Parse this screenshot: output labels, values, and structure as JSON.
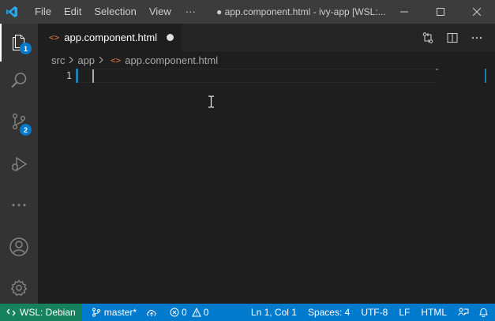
{
  "titlebar": {
    "menu": [
      "File",
      "Edit",
      "Selection",
      "View",
      "···"
    ],
    "window_title": "● app.component.html - ivy-app [WSL:...",
    "controls": [
      "minimize-icon",
      "maximize-icon",
      "close-icon"
    ],
    "logo": "vscode-logo-icon"
  },
  "activitybar": {
    "items": [
      {
        "name": "explorer",
        "icon": "files-icon",
        "badge": "1"
      },
      {
        "name": "search",
        "icon": "search-icon"
      },
      {
        "name": "source-control",
        "icon": "source-control-icon",
        "badge": "2"
      },
      {
        "name": "run-debug",
        "icon": "debug-icon"
      },
      {
        "name": "more",
        "icon": "ellipsis-icon"
      }
    ],
    "bottom": [
      {
        "name": "accounts",
        "icon": "account-icon"
      },
      {
        "name": "manage",
        "icon": "gear-icon"
      }
    ]
  },
  "editor": {
    "tab": {
      "icon": "<>",
      "label": "app.component.html",
      "dirty": true
    },
    "actions": [
      "open-changes-icon",
      "split-editor-icon",
      "more-actions-icon"
    ],
    "breadcrumb": {
      "parts": [
        "src",
        "app"
      ],
      "file_icon": "<>",
      "file": "app.component.html"
    },
    "lines": [
      "1"
    ]
  },
  "statusbar": {
    "remote": "WSL: Debian",
    "branch": "master*",
    "errors": "0",
    "warnings": "0",
    "position": "Ln 1, Col 1",
    "indent": "Spaces: 4",
    "encoding": "UTF-8",
    "eol": "LF",
    "language": "HTML"
  },
  "colors": {
    "accent": "#007acc",
    "remote": "#16825d",
    "html_icon": "#e37933"
  }
}
